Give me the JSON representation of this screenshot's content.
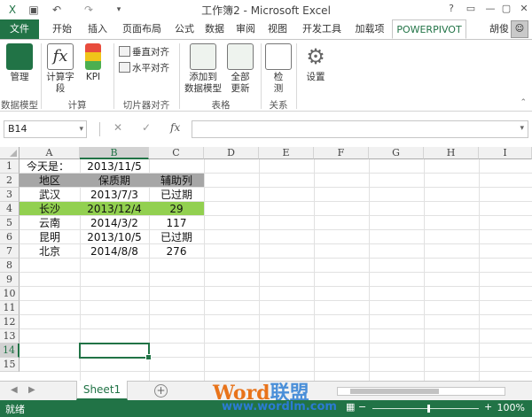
{
  "window": {
    "title": "工作簿2 - Microsoft Excel"
  },
  "tabs": [
    "文件",
    "开始",
    "插入",
    "页面布局",
    "公式",
    "数据",
    "审阅",
    "视图",
    "开发工具",
    "加载项",
    "POWERPIVOT"
  ],
  "user": "胡俊",
  "ribbon": {
    "manage": "管理",
    "calc_field_1": "计算字",
    "calc_field_2": "段",
    "kpi": "KPI",
    "vert_align": "垂直对齐",
    "horiz_align": "水平对齐",
    "add_model_1": "添加到",
    "add_model_2": "数据模型",
    "refresh_all_1": "全部",
    "refresh_all_2": "更新",
    "detect_1": "检",
    "detect_2": "测",
    "settings": "设置",
    "groups": [
      "数据模型",
      "计算",
      "切片器对齐",
      "表格",
      "关系"
    ]
  },
  "name_box": "B14",
  "fx": "fx",
  "columns": [
    "A",
    "B",
    "C",
    "D",
    "E",
    "F",
    "G",
    "H",
    "I"
  ],
  "rows": [
    "1",
    "2",
    "3",
    "4",
    "5",
    "6",
    "7",
    "8",
    "9",
    "10",
    "11",
    "12",
    "13",
    "14",
    "15"
  ],
  "cells": {
    "r1": [
      "今天是：",
      "2013/11/5",
      ""
    ],
    "r2": [
      "地区",
      "保质期",
      "辅助列"
    ],
    "r3": [
      "武汉",
      "2013/7/3",
      "已过期"
    ],
    "r4": [
      "长沙",
      "2013/12/4",
      "29"
    ],
    "r5": [
      "云南",
      "2014/3/2",
      "117"
    ],
    "r6": [
      "昆明",
      "2013/10/5",
      "已过期"
    ],
    "r7": [
      "北京",
      "2014/8/8",
      "276"
    ]
  },
  "colors": {
    "excel_green": "#217346",
    "header_gray": "#a6a6a6",
    "highlight_green": "#92d050"
  },
  "sheet_tab": "Sheet1",
  "status": {
    "ready": "就绪",
    "zoom": "100%"
  },
  "watermark": {
    "word": "Word",
    "cn": "联盟",
    "url": "www.wordlm.com"
  }
}
